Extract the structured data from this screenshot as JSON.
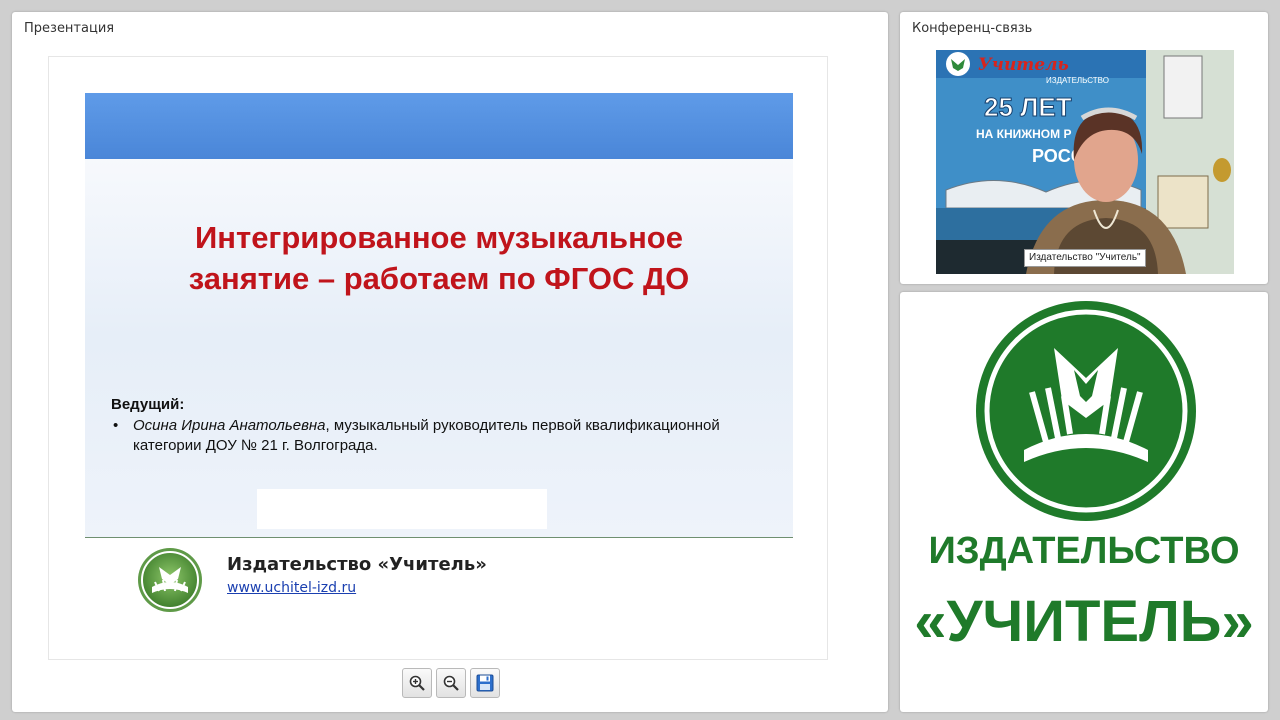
{
  "presentation_panel": {
    "title": "Презентация"
  },
  "slide": {
    "title_line1": "Интегрированное музыкальное",
    "title_line2": "занятие – работаем по ФГОС ДО",
    "host_label": "Ведущий:",
    "host_bullet": "•",
    "host_name": "Осина Ирина Анатольевна",
    "host_desc_line1": ", музыкальный руководитель первой квалификационной",
    "host_desc_line2": "категории ДОУ № 21 г. Волгограда.",
    "footer_name": "Издательство «Учитель»",
    "footer_url": "www.uchitel-izd.ru"
  },
  "toolbar": {
    "zoom_in_icon": "zoom-in-icon",
    "zoom_out_icon": "zoom-out-icon",
    "save_icon": "floppy-disk-icon"
  },
  "conference_panel": {
    "title": "Конференц-связь",
    "participant_label": "Издательство \"Учитель\"",
    "banner_brand": "Учитель",
    "banner_sub": "ИЗДАТЕЛЬСТВО",
    "banner_years": "25 ЛЕТ",
    "banner_line": "НА КНИЖНОМ Р",
    "banner_line2": "РОСС"
  },
  "logo_panel": {
    "line1": "ИЗДАТЕЛЬСТВО",
    "line2": "«УЧИТЕЛЬ»"
  },
  "colors": {
    "brand_green": "#1f7a2a",
    "title_red": "#c0141b",
    "band_blue": "#5f9be8"
  }
}
